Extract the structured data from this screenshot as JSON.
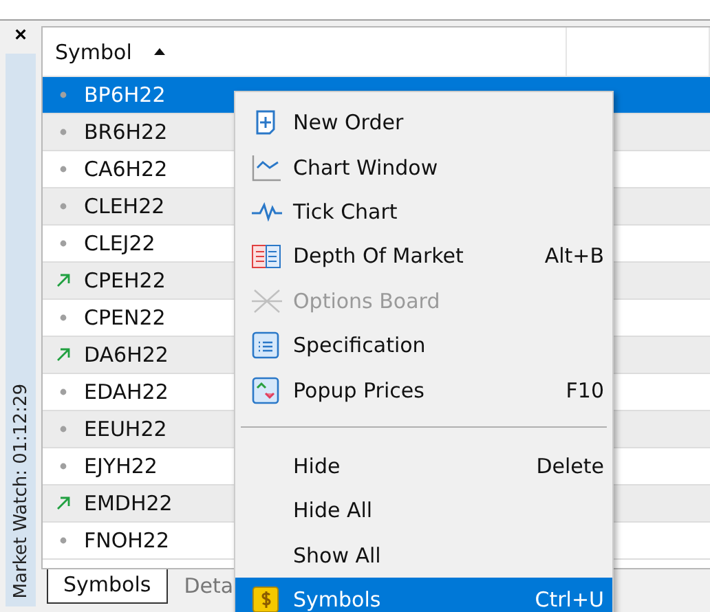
{
  "side_panel": {
    "close": "×",
    "title": "Market Watch: 01:12:29"
  },
  "table": {
    "header": {
      "label": "Symbol",
      "sorted_ascending": true
    },
    "rows": [
      {
        "symbol": "BP6H22",
        "rising": false,
        "selected": true
      },
      {
        "symbol": "BR6H22",
        "rising": false,
        "selected": false
      },
      {
        "symbol": "CA6H22",
        "rising": false,
        "selected": false
      },
      {
        "symbol": "CLEH22",
        "rising": false,
        "selected": false
      },
      {
        "symbol": "CLEJ22",
        "rising": false,
        "selected": false
      },
      {
        "symbol": "CPEH22",
        "rising": true,
        "selected": false
      },
      {
        "symbol": "CPEN22",
        "rising": false,
        "selected": false
      },
      {
        "symbol": "DA6H22",
        "rising": true,
        "selected": false
      },
      {
        "symbol": "EDAH22",
        "rising": false,
        "selected": false
      },
      {
        "symbol": "EEUH22",
        "rising": false,
        "selected": false
      },
      {
        "symbol": "EJYH22",
        "rising": false,
        "selected": false
      },
      {
        "symbol": "EMDH22",
        "rising": true,
        "selected": false
      },
      {
        "symbol": "FNOH22",
        "rising": false,
        "selected": false
      }
    ]
  },
  "tabs": [
    {
      "label": "Symbols",
      "selected": true
    },
    {
      "label": "Deta",
      "selected": false
    }
  ],
  "context_menu": {
    "items": [
      {
        "kind": "item",
        "label": "New Order",
        "disabled": false,
        "selected": false
      },
      {
        "kind": "item",
        "label": "Chart Window",
        "disabled": false,
        "selected": false
      },
      {
        "kind": "item",
        "label": "Tick Chart",
        "disabled": false,
        "selected": false
      },
      {
        "kind": "item",
        "label": "Depth Of Market",
        "shortcut": "Alt+B",
        "disabled": false,
        "selected": false
      },
      {
        "kind": "item",
        "label": "Options Board",
        "disabled": true,
        "selected": false
      },
      {
        "kind": "item",
        "label": "Specification",
        "disabled": false,
        "selected": false
      },
      {
        "kind": "item",
        "label": "Popup Prices",
        "shortcut": "F10",
        "disabled": false,
        "selected": false
      },
      {
        "kind": "separator"
      },
      {
        "kind": "item",
        "label": "Hide",
        "shortcut": "Delete",
        "disabled": false,
        "selected": false
      },
      {
        "kind": "item",
        "label": "Hide All",
        "disabled": false,
        "selected": false
      },
      {
        "kind": "item",
        "label": "Show All",
        "disabled": false,
        "selected": false
      },
      {
        "kind": "item",
        "label": "Symbols",
        "shortcut": "Ctrl+U",
        "disabled": false,
        "selected": true
      }
    ]
  }
}
